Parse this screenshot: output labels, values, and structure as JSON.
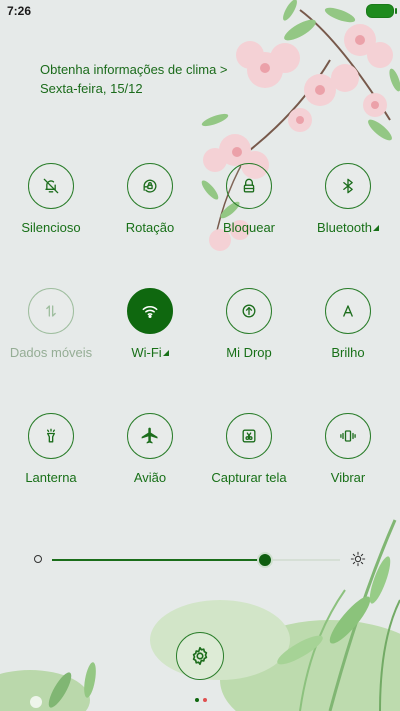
{
  "status_bar": {
    "time": "7:26"
  },
  "weather": {
    "line1": "Obtenha informações de clima >",
    "line2": "Sexta-feira, 15/12"
  },
  "tiles": [
    {
      "label": "Silencioso",
      "icon": "bell-off-icon"
    },
    {
      "label": "Rotação",
      "icon": "rotation-lock-icon"
    },
    {
      "label": "Bloquear",
      "icon": "lock-icon"
    },
    {
      "label": "Bluetooth",
      "icon": "bluetooth-icon"
    },
    {
      "label": "Dados móveis",
      "icon": "mobile-data-icon"
    },
    {
      "label": "Wi-Fi",
      "icon": "wifi-icon"
    },
    {
      "label": "Mi Drop",
      "icon": "mi-drop-icon"
    },
    {
      "label": "Brilho",
      "icon": "brightness-auto-icon"
    },
    {
      "label": "Lanterna",
      "icon": "flashlight-icon"
    },
    {
      "label": "Avião",
      "icon": "airplane-icon"
    },
    {
      "label": "Capturar tela",
      "icon": "screenshot-icon"
    },
    {
      "label": "Vibrar",
      "icon": "vibrate-icon"
    }
  ],
  "tile_states": {
    "wifi_active": true,
    "mobile_data_disabled": true
  },
  "brightness": {
    "level": 0.74
  },
  "pager": {
    "pages": 2,
    "current": 1
  },
  "colors": {
    "accent": "#0f680f",
    "text": "#187018",
    "disabled": "#95ad95",
    "page_dot_inactive": "#e05050"
  }
}
